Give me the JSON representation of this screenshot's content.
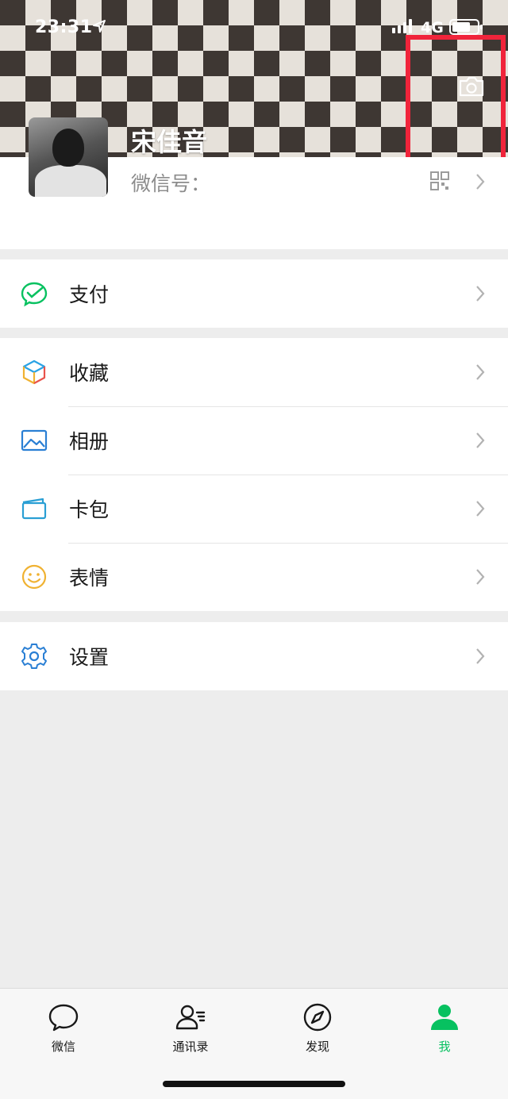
{
  "status_bar": {
    "time": "23:31",
    "network": "4G"
  },
  "profile": {
    "name": "宋佳音",
    "wechat_id_label": "微信号：",
    "wechat_id_value": ""
  },
  "menu": {
    "pay": {
      "label": "支付",
      "icon": "wechat-pay-icon"
    },
    "favorites": {
      "label": "收藏",
      "icon": "favorites-cube-icon"
    },
    "album": {
      "label": "相册",
      "icon": "album-icon"
    },
    "cards": {
      "label": "卡包",
      "icon": "card-wallet-icon"
    },
    "stickers": {
      "label": "表情",
      "icon": "emoji-icon"
    },
    "settings": {
      "label": "设置",
      "icon": "gear-icon"
    }
  },
  "tabs": [
    {
      "label": "微信",
      "icon": "chat-bubble-icon",
      "active": false
    },
    {
      "label": "通讯录",
      "icon": "contacts-icon",
      "active": false
    },
    {
      "label": "发现",
      "icon": "compass-icon",
      "active": false
    },
    {
      "label": "我",
      "icon": "person-icon",
      "active": true
    }
  ],
  "colors": {
    "accent": "#07C160",
    "highlight_box": "#F0243B",
    "page_bg": "#EDEDED"
  }
}
